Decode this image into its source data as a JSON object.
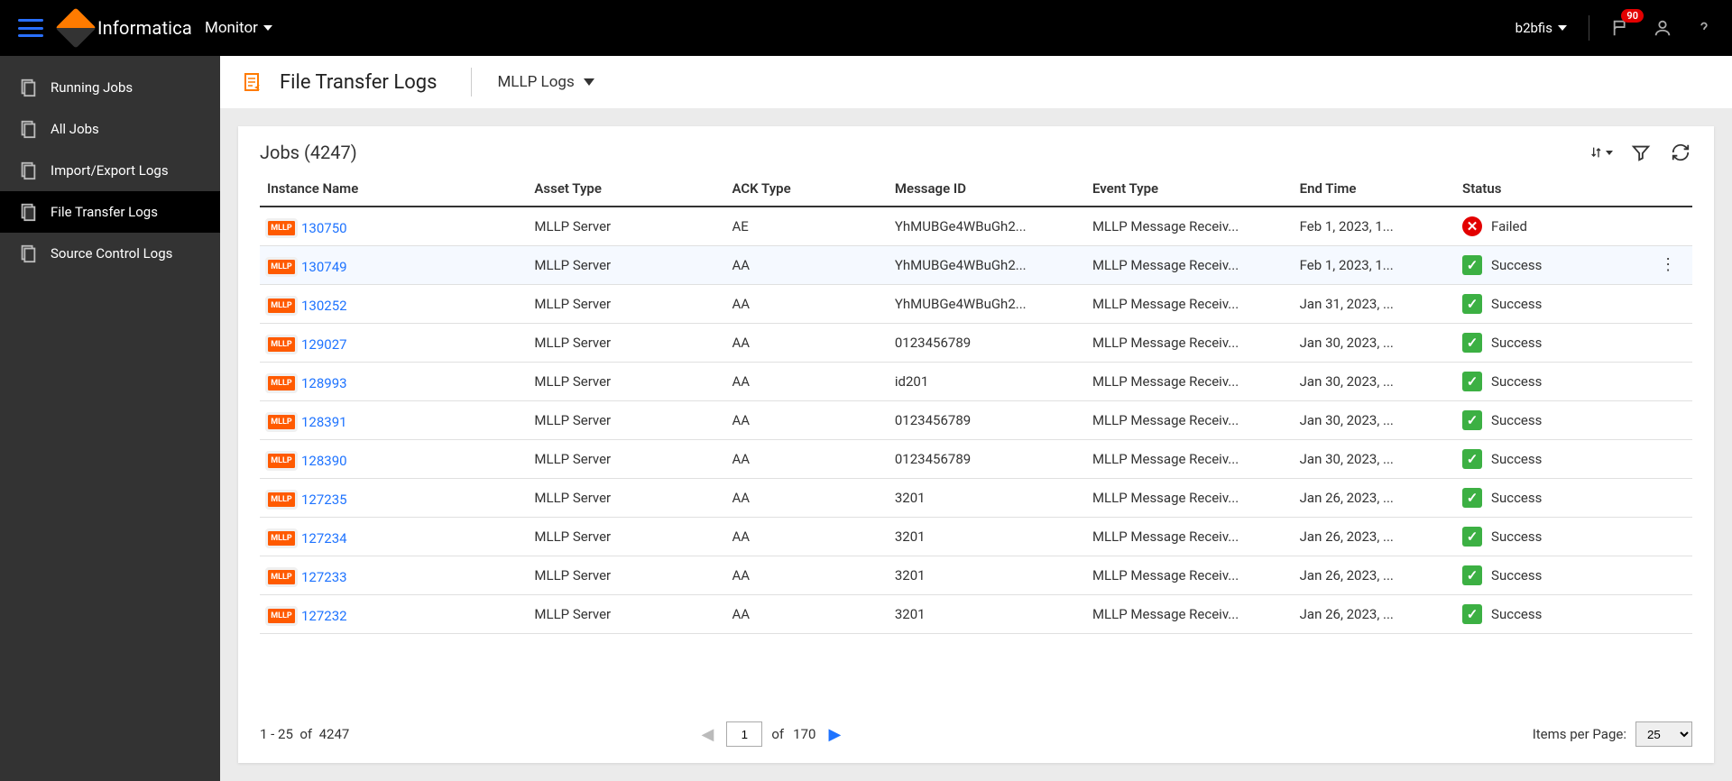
{
  "header": {
    "brand": "Informatica",
    "app": "Monitor",
    "username": "b2bfis",
    "notification_count": "90"
  },
  "sidebar": {
    "items": [
      {
        "label": "Running Jobs"
      },
      {
        "label": "All Jobs"
      },
      {
        "label": "Import/Export Logs"
      },
      {
        "label": "File Transfer Logs"
      },
      {
        "label": "Source Control Logs"
      }
    ],
    "active_index": 3
  },
  "page": {
    "title": "File Transfer Logs",
    "subtype": "MLLP Logs"
  },
  "panel": {
    "title_prefix": "Jobs",
    "total": "4247"
  },
  "table": {
    "headers": [
      "Instance Name",
      "Asset Type",
      "ACK Type",
      "Message ID",
      "Event Type",
      "End Time",
      "Status"
    ],
    "icon_label": "MLLP",
    "rows": [
      {
        "instance": "130750",
        "asset": "MLLP Server",
        "ack": "AE",
        "msg": "YhMUBGe4WBuGh2...",
        "evt": "MLLP Message Receiv...",
        "end": "Feb 1, 2023, 1...",
        "status": "Failed",
        "ok": false
      },
      {
        "instance": "130749",
        "asset": "MLLP Server",
        "ack": "AA",
        "msg": "YhMUBGe4WBuGh2...",
        "evt": "MLLP Message Receiv...",
        "end": "Feb 1, 2023, 1...",
        "status": "Success",
        "ok": true,
        "hover": true
      },
      {
        "instance": "130252",
        "asset": "MLLP Server",
        "ack": "AA",
        "msg": "YhMUBGe4WBuGh2...",
        "evt": "MLLP Message Receiv...",
        "end": "Jan 31, 2023, ...",
        "status": "Success",
        "ok": true
      },
      {
        "instance": "129027",
        "asset": "MLLP Server",
        "ack": "AA",
        "msg": "0123456789",
        "evt": "MLLP Message Receiv...",
        "end": "Jan 30, 2023, ...",
        "status": "Success",
        "ok": true
      },
      {
        "instance": "128993",
        "asset": "MLLP Server",
        "ack": "AA",
        "msg": "id201",
        "evt": "MLLP Message Receiv...",
        "end": "Jan 30, 2023, ...",
        "status": "Success",
        "ok": true
      },
      {
        "instance": "128391",
        "asset": "MLLP Server",
        "ack": "AA",
        "msg": "0123456789",
        "evt": "MLLP Message Receiv...",
        "end": "Jan 30, 2023, ...",
        "status": "Success",
        "ok": true
      },
      {
        "instance": "128390",
        "asset": "MLLP Server",
        "ack": "AA",
        "msg": "0123456789",
        "evt": "MLLP Message Receiv...",
        "end": "Jan 30, 2023, ...",
        "status": "Success",
        "ok": true
      },
      {
        "instance": "127235",
        "asset": "MLLP Server",
        "ack": "AA",
        "msg": "3201",
        "evt": "MLLP Message Receiv...",
        "end": "Jan 26, 2023, ...",
        "status": "Success",
        "ok": true
      },
      {
        "instance": "127234",
        "asset": "MLLP Server",
        "ack": "AA",
        "msg": "3201",
        "evt": "MLLP Message Receiv...",
        "end": "Jan 26, 2023, ...",
        "status": "Success",
        "ok": true
      },
      {
        "instance": "127233",
        "asset": "MLLP Server",
        "ack": "AA",
        "msg": "3201",
        "evt": "MLLP Message Receiv...",
        "end": "Jan 26, 2023, ...",
        "status": "Success",
        "ok": true
      },
      {
        "instance": "127232",
        "asset": "MLLP Server",
        "ack": "AA",
        "msg": "3201",
        "evt": "MLLP Message Receiv...",
        "end": "Jan 26, 2023, ...",
        "status": "Success",
        "ok": true
      }
    ]
  },
  "pager": {
    "range": "1 - 25",
    "of_label": "of",
    "total": "4247",
    "current_page": "1",
    "total_pages": "170",
    "items_label": "Items per Page:",
    "items_value": "25"
  }
}
